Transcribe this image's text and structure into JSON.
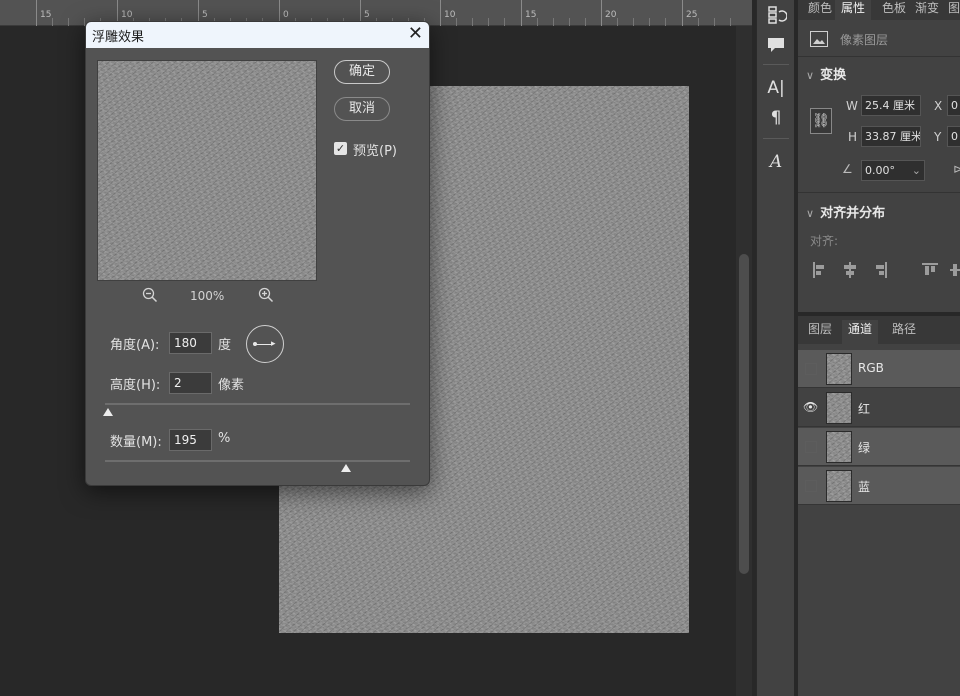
{
  "ruler": {
    "labels": [
      "15",
      "10",
      "5",
      "0",
      "5",
      "10",
      "15",
      "20",
      "25"
    ]
  },
  "dialog": {
    "title": "浮雕效果",
    "ok_label": "确定",
    "cancel_label": "取消",
    "preview_label": "预览(P)",
    "preview_checked": true,
    "zoom_level": "100%",
    "angle": {
      "label": "角度(A):",
      "value": "180",
      "unit": "度"
    },
    "height": {
      "label": "高度(H):",
      "value": "2",
      "unit": "像素",
      "slider_fraction": 0.01
    },
    "amount": {
      "label": "数量(M):",
      "value": "195",
      "unit": "%",
      "slider_fraction": 0.79
    }
  },
  "properties_panel": {
    "tabs": [
      "颜色",
      "属性",
      "色板",
      "渐变",
      "图"
    ],
    "active_tab": "属性",
    "layer_type": "像素图层",
    "transform": {
      "heading": "变换",
      "w_label": "W",
      "w_value": "25.4 厘米",
      "h_label": "H",
      "h_value": "33.87 厘米",
      "x_label": "X",
      "x_value": "0",
      "y_label": "Y",
      "y_value": "0",
      "angle_value": "0.00°"
    },
    "align": {
      "heading": "对齐并分布",
      "sublabel": "对齐:"
    }
  },
  "channels_panel": {
    "tabs": [
      "图层",
      "通道",
      "路径"
    ],
    "active_tab": "通道",
    "channels": [
      {
        "name": "RGB",
        "visible": false,
        "selected": true
      },
      {
        "name": "红",
        "visible": true,
        "selected": false
      },
      {
        "name": "绿",
        "visible": false,
        "selected": true
      },
      {
        "name": "蓝",
        "visible": false,
        "selected": true
      }
    ]
  },
  "icons": {
    "toolstrip": [
      "history-icon",
      "comment-icon",
      "character-icon",
      "paragraph-icon",
      "glyphs-icon"
    ],
    "zoom_out": "zoom-out-icon",
    "zoom_in": "zoom-in-icon"
  }
}
